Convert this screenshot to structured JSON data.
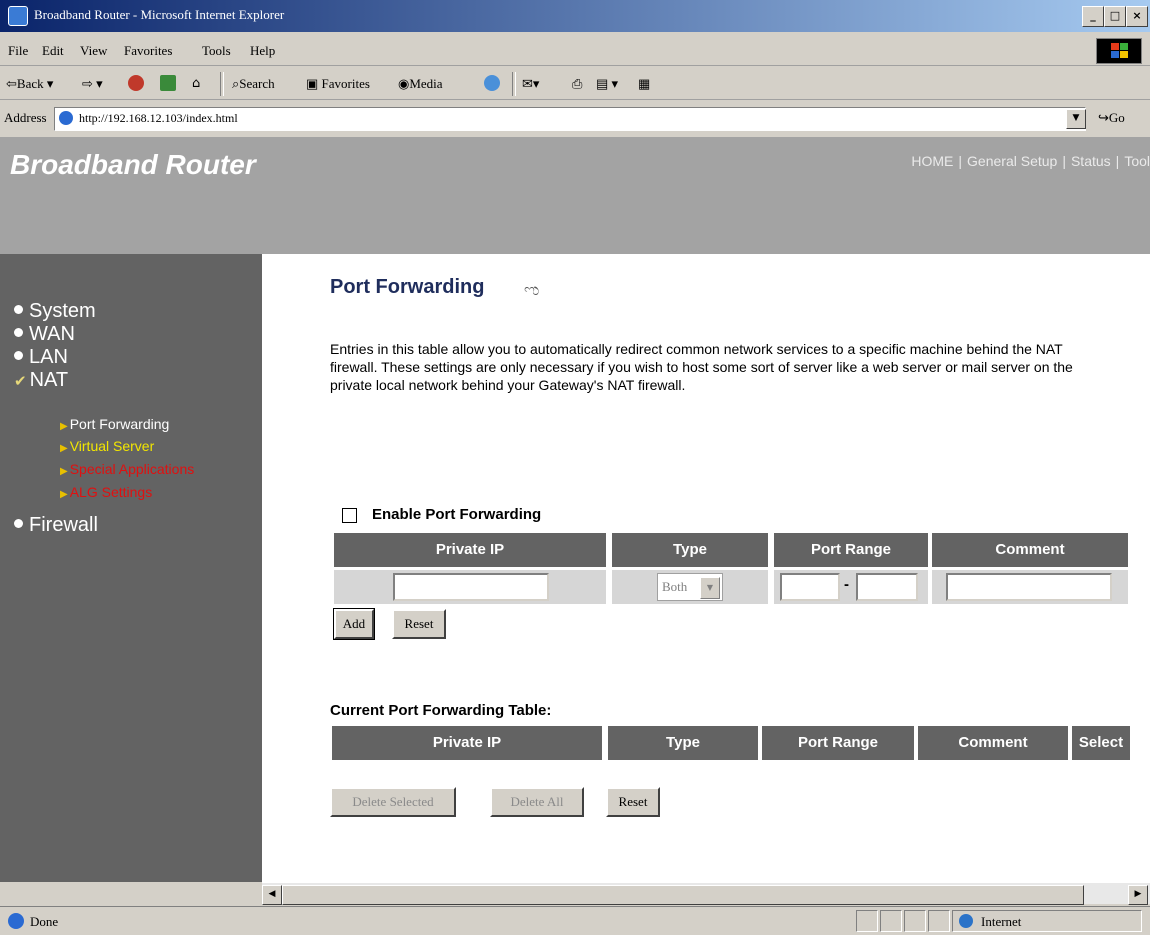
{
  "window": {
    "title": "Broadband Router - Microsoft Internet Explorer",
    "controls": {
      "minimize": "_",
      "maximize": "□",
      "close": "×"
    }
  },
  "menu": [
    "File",
    "Edit",
    "View",
    "Favorites",
    "Tools",
    "Help"
  ],
  "toolbar": {
    "back": "Back",
    "search": "Search",
    "favorites": "Favorites",
    "media": "Media"
  },
  "address": {
    "label": "Address",
    "url": "http://192.168.12.103/index.html",
    "go": "Go"
  },
  "page": {
    "brand": "Broadband Router",
    "top_nav": [
      "HOME",
      "General Setup",
      "Status",
      "Tool"
    ],
    "sidebar": {
      "items": [
        {
          "label": "System",
          "icon": "bullet-icon"
        },
        {
          "label": "WAN",
          "icon": "bullet-icon"
        },
        {
          "label": "LAN",
          "icon": "bullet-icon"
        },
        {
          "label": "NAT",
          "icon": "check-icon"
        },
        {
          "label": "Firewall",
          "icon": "bullet-icon"
        }
      ],
      "sub_items": [
        {
          "label": "Port Forwarding",
          "color": "#ffffff"
        },
        {
          "label": "Virtual Server",
          "color": "#f2e600"
        },
        {
          "label": "Special Applications",
          "color": "#e01010"
        },
        {
          "label": "ALG Settings",
          "color": "#e01010"
        }
      ]
    },
    "title": "Port Forwarding",
    "description": "Entries in this table allow you to automatically redirect common network services to a specific machine behind the NAT firewall. These settings are only necessary if you wish to host some sort of server like a web server or mail server on the private local network behind your Gateway's NAT firewall.",
    "enable_label": "Enable Port Forwarding",
    "entry_table": {
      "headers": [
        "Private IP",
        "Type",
        "Port Range",
        "Comment"
      ],
      "type_value": "Both",
      "range_separator": "-"
    },
    "add_button": "Add",
    "reset_button": "Reset",
    "current_table": {
      "title": "Current Port Forwarding Table:",
      "headers": [
        "Private IP",
        "Type",
        "Port Range",
        "Comment",
        "Select"
      ]
    },
    "delete_selected_button": "Delete Selected",
    "delete_all_button": "Delete All",
    "reset_button_2": "Reset"
  },
  "status": {
    "text": "Done",
    "zone": "Internet"
  },
  "colors": {
    "banner": "#a3a3a3",
    "sidebar": "#636363",
    "table_header": "#636363",
    "title": "#1f2d5c"
  }
}
